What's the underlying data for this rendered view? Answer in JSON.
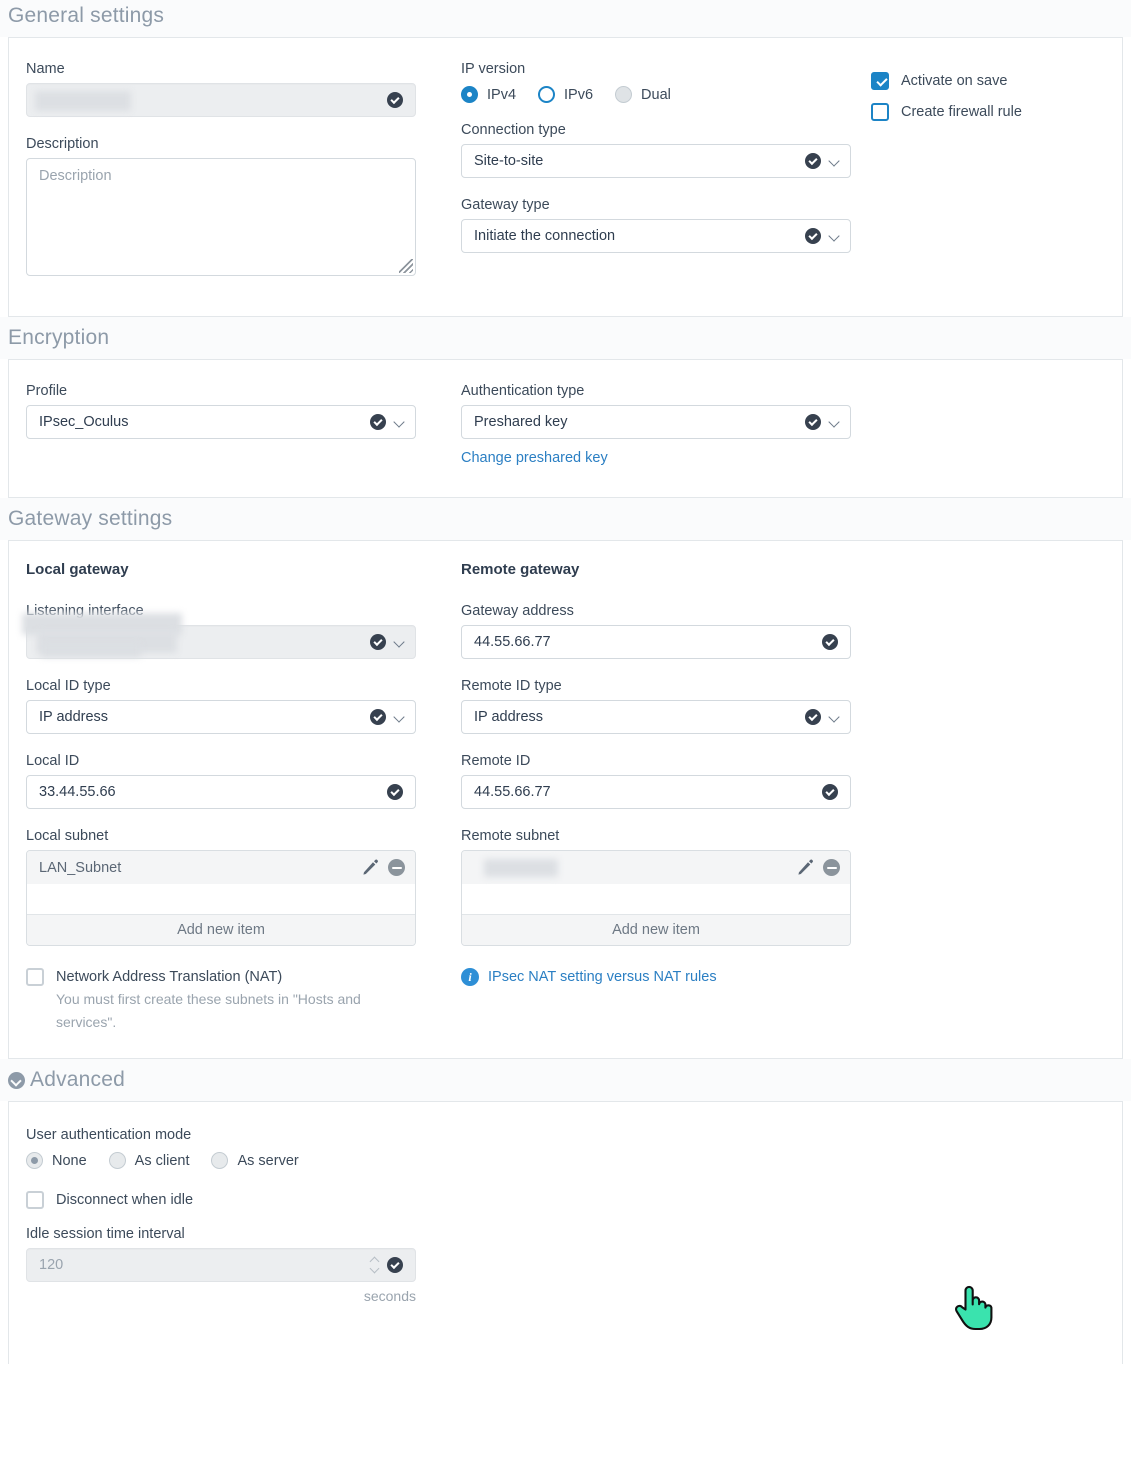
{
  "sections": {
    "general": "General settings",
    "encryption": "Encryption",
    "gateway": "Gateway settings",
    "advanced": "Advanced"
  },
  "general": {
    "name_label": "Name",
    "name_value": "",
    "description_label": "Description",
    "description_placeholder": "Description",
    "description_value": "",
    "ip_version_label": "IP version",
    "ip_version_options": [
      "IPv4",
      "IPv6",
      "Dual"
    ],
    "ip_version_selected": "IPv4",
    "connection_type_label": "Connection type",
    "connection_type_value": "Site-to-site",
    "gateway_type_label": "Gateway type",
    "gateway_type_value": "Initiate the connection",
    "activate_on_save_label": "Activate on save",
    "activate_on_save_checked": true,
    "create_firewall_rule_label": "Create firewall rule",
    "create_firewall_rule_checked": false
  },
  "encryption": {
    "profile_label": "Profile",
    "profile_value": "IPsec_Oculus",
    "auth_type_label": "Authentication type",
    "auth_type_value": "Preshared key",
    "change_key_link": "Change preshared key"
  },
  "gateway": {
    "local_title": "Local gateway",
    "remote_title": "Remote gateway",
    "listening_interface_label": "Listening interface",
    "listening_interface_value": "",
    "gateway_address_label": "Gateway address",
    "gateway_address_value": "44.55.66.77",
    "local_id_type_label": "Local ID type",
    "local_id_type_value": "IP address",
    "remote_id_type_label": "Remote ID type",
    "remote_id_type_value": "IP address",
    "local_id_label": "Local ID",
    "local_id_value": "33.44.55.66",
    "remote_id_label": "Remote ID",
    "remote_id_value": "44.55.66.77",
    "local_subnet_label": "Local subnet",
    "local_subnet_items": [
      "LAN_Subnet"
    ],
    "remote_subnet_label": "Remote subnet",
    "remote_subnet_items": [
      ""
    ],
    "add_new_item_label": "Add new item",
    "nat_label": "Network Address Translation (NAT)",
    "nat_checked": false,
    "nat_help": "You must first create these subnets in \"Hosts and services\".",
    "nat_link": "IPsec NAT setting versus NAT rules"
  },
  "advanced": {
    "user_auth_mode_label": "User authentication mode",
    "user_auth_mode_options": [
      "None",
      "As client",
      "As server"
    ],
    "user_auth_mode_selected": "None",
    "disconnect_when_idle_label": "Disconnect when idle",
    "disconnect_when_idle_checked": false,
    "idle_interval_label": "Idle session time interval",
    "idle_interval_value": "120",
    "idle_interval_units": "seconds"
  },
  "colors": {
    "accent": "#1c84c6",
    "link": "#2b7fc3",
    "check_badge": "#37414f",
    "section_header": "#8d9aa8",
    "cursor": "#3ae3ae"
  }
}
